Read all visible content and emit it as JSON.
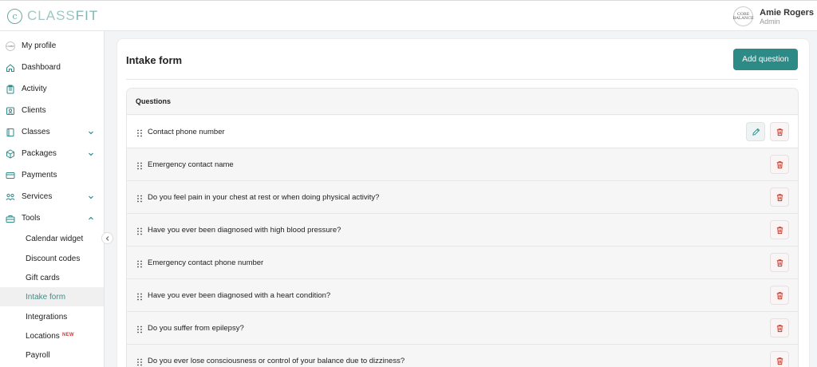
{
  "app": {
    "logo_mark": "c",
    "name_part1": "CLASS",
    "name_part2": "FIT"
  },
  "user": {
    "name": "Amie Rogers",
    "role": "Admin",
    "avatar_text": "CORE BALANCE"
  },
  "sidebar": {
    "items": [
      {
        "label": "My profile",
        "icon": "profile-avatar"
      },
      {
        "label": "Dashboard",
        "icon": "home-icon"
      },
      {
        "label": "Activity",
        "icon": "clipboard-icon"
      },
      {
        "label": "Clients",
        "icon": "users-icon"
      },
      {
        "label": "Classes",
        "icon": "book-icon"
      },
      {
        "label": "Packages",
        "icon": "box-icon"
      },
      {
        "label": "Payments",
        "icon": "card-icon"
      },
      {
        "label": "Services",
        "icon": "services-icon"
      },
      {
        "label": "Tools",
        "icon": "toolbox-icon"
      }
    ],
    "tools_sub": [
      {
        "label": "Calendar widget"
      },
      {
        "label": "Discount codes"
      },
      {
        "label": "Gift cards"
      },
      {
        "label": "Intake form"
      },
      {
        "label": "Integrations"
      },
      {
        "label": "Locations",
        "badge": "NEW"
      },
      {
        "label": "Payroll"
      }
    ]
  },
  "page": {
    "title": "Intake form",
    "add_button": "Add question"
  },
  "questions": {
    "header": "Questions",
    "rows": [
      "Contact phone number",
      "Emergency contact name",
      "Do you feel pain in your chest at rest or when doing physical activity?",
      "Have you ever been diagnosed with high blood pressure?",
      "Emergency contact phone number",
      "Have you ever been diagnosed with a heart condition?",
      "Do you suffer from epilepsy?",
      "Do you ever lose consciousness or control of your balance due to dizziness?"
    ]
  },
  "colors": {
    "accent": "#2e8a87",
    "active_text": "#3a8f8a",
    "delete": "#c0392b",
    "badge": "#dd3333"
  }
}
